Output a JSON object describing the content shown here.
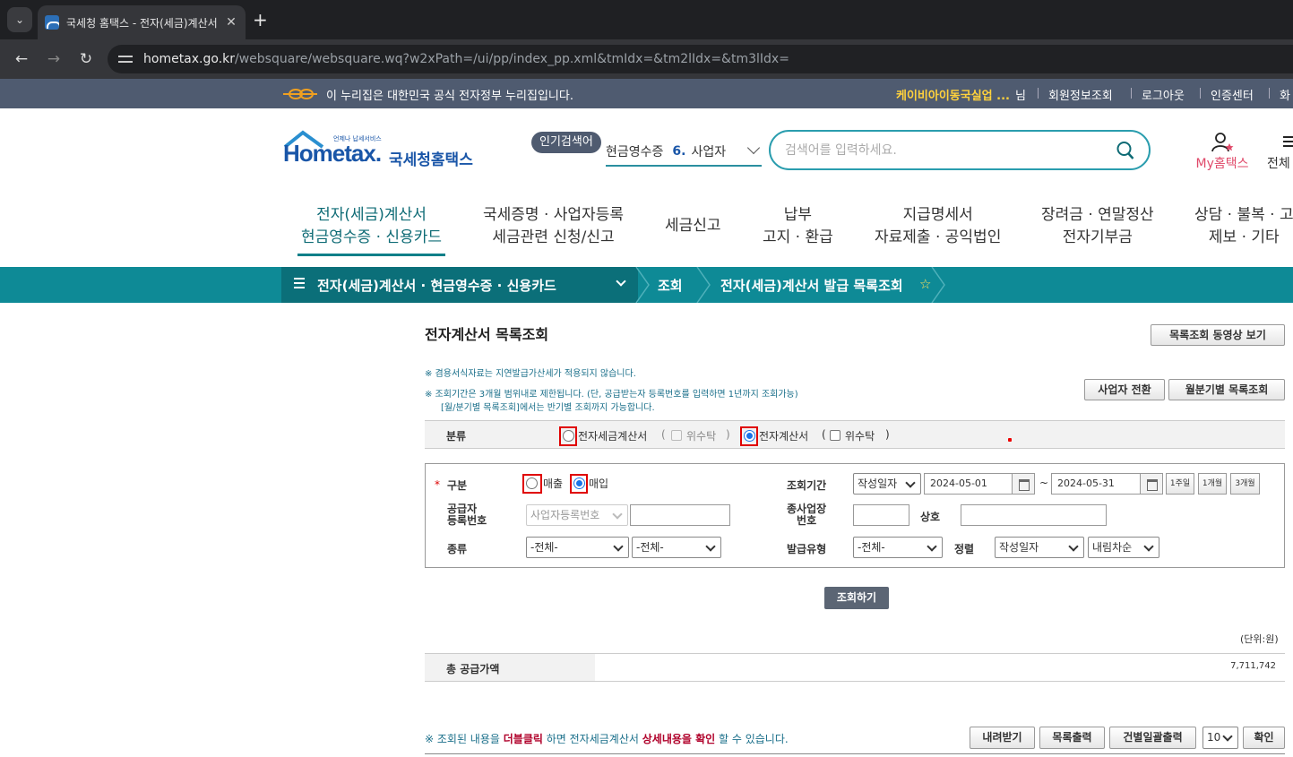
{
  "browser": {
    "tab_title": "국세청 홈택스 - 전자(세금)계산서",
    "tab_close": "✕",
    "new_tab": "+",
    "menu": "⌄",
    "url_host": "hometax.go.kr",
    "url_path": "/websquare/websquare.wq?w2xPath=/ui/pp/index_pp.xml&tmIdx=&tm2lIdx=&tm3lIdx="
  },
  "gov_banner": {
    "text": "이 누리집은 대한민국 공식 전자정부 누리집입니다.",
    "user_name": "케이비아이동국실업 ...",
    "user_suffix": "님",
    "links": [
      "회원정보조회",
      "로그아웃",
      "인증센터",
      "화"
    ]
  },
  "header": {
    "logo_home": "Hometax.",
    "logo_sub": "언제나 납세서비스",
    "logo_korean": "국세청홈택스",
    "popular_badge": "인기검색어",
    "popular_prev": "현금영수증",
    "popular_rank": "6.",
    "popular_term": "사업자",
    "search_placeholder": "검색어를 입력하세요.",
    "myhometax": "My홈택스",
    "all_menu": "전체"
  },
  "gnb": [
    {
      "line1": "전자(세금)계산서",
      "line2": "현금영수증 · 신용카드"
    },
    {
      "line1": "국세증명 · 사업자등록",
      "line2": "세금관련 신청/신고"
    },
    {
      "line1": "세금신고",
      "line2": ""
    },
    {
      "line1": "납부",
      "line2": "고지 · 환급"
    },
    {
      "line1": "지급명세서",
      "line2": "자료제출 · 공익법인"
    },
    {
      "line1": "장려금 · 연말정산",
      "line2": "전자기부금"
    },
    {
      "line1": "상담 · 불복 · 고",
      "line2": "제보 · 기타"
    }
  ],
  "breadcrumb": {
    "level1": "전자(세금)계산서 · 현금영수증 · 신용카드",
    "level2": "조회",
    "level3": "전자(세금)계산서 발급 목록조회",
    "favorite": "☆"
  },
  "content": {
    "title": "전자계산서 목록조회",
    "video_button": "목록조회 동영상 보기",
    "notice1": "※ 겸용서식자료는 지연발급가산세가 적용되지 않습니다.",
    "notice2": "※ 조회기간은 3개월 범위내로 제한됩니다. (단, 공급받는자 등록번호를 입력하면 1년까지 조회가능)",
    "notice3": "[월/분기별 목록조회]에서는 반기별 조회까지 가능합니다.",
    "switch_business_button": "사업자 전환",
    "monthly_button": "월분기별 목록조회",
    "classification": {
      "label": "분류",
      "option1": "전자세금계산서",
      "paren_open1": "(",
      "trust1": "위수탁",
      "paren_close1": ")",
      "option2": "전자계산서",
      "paren_open2": "(",
      "trust2": "위수탁",
      "paren_close2": ")"
    },
    "form": {
      "type_label": "구분",
      "type_sales": "매출",
      "type_purchase": "매입",
      "period_label": "조회기간",
      "date_basis": "작성일자",
      "date_from": "2024-05-01",
      "tilde": "~",
      "date_to": "2024-05-31",
      "quick1": "1주일",
      "quick2": "1개월",
      "quick3": "3개월",
      "supplier_label_1": "공급자",
      "supplier_label_2": "등록번호",
      "supplier_select": "사업자등록번호",
      "supplier_value": "",
      "branch_label_1": "종사업장",
      "branch_label_2": "번호",
      "branch_value": "",
      "company_label": "상호",
      "company_value": "",
      "kind_label": "종류",
      "kind_select1": "-전체-",
      "kind_select2": "-전체-",
      "issue_type_label": "발급유형",
      "issue_type_select": "-전체-",
      "sort_label": "정렬",
      "sort_select": "작성일자",
      "order_select": "내림차순"
    },
    "search_button": "조회하기",
    "unit": "(단위:원)",
    "total_label": "총 공급가액",
    "total_value": "7,711,742",
    "bottom_note_1": "※ 조회된 내용을 ",
    "bottom_note_em1": "더블클릭",
    "bottom_note_2": " 하면 전자세금계산서 ",
    "bottom_note_em2": "상세내용을 확인",
    "bottom_note_3": " 할 수 있습니다.",
    "download_button": "내려받기",
    "print_button": "목록출력",
    "bulk_print_button": "건별일괄출력",
    "page_size": "10",
    "confirm_button": "확인"
  }
}
